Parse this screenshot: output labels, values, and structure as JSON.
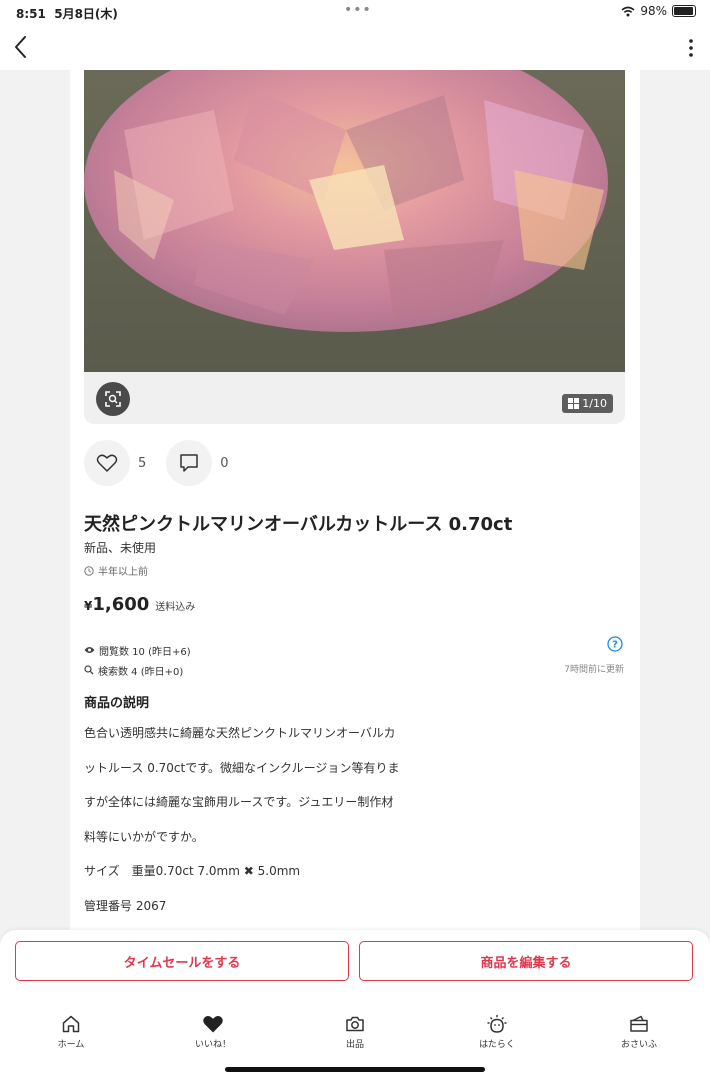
{
  "status_bar": {
    "time": "8:51",
    "date": "5月8日(木)",
    "battery": "98%"
  },
  "item": {
    "image_counter": "1/10",
    "likes": "5",
    "comments": "0",
    "title": "天然ピンクトルマリンオーバルカットルース 0.70ct",
    "condition": "新品、未使用",
    "posted": "半年以上前",
    "price_symbol": "¥",
    "price": "1,600",
    "shipping": "送料込み"
  },
  "stats": {
    "views": "閲覧数  10 (昨日+6)",
    "searches": "検索数  4 (昨日+0)",
    "updated": "7時間前に更新"
  },
  "description": {
    "heading": "商品の説明",
    "lines": [
      "色合い透明感共に綺麗な天然ピンクトルマリンオーバルカ",
      "ットルース 0.70ctです。微細なインクルージョン等有りま",
      "すが全体には綺麗な宝飾用ルースです。ジュエリー制作材",
      "料等にいかがですか。",
      "サイズ　重量0.70ct 7.0mm ✖ 5.0mm",
      "管理番号 2067"
    ]
  },
  "actions": {
    "timesale": "タイムセールをする",
    "edit": "商品を編集する"
  },
  "tabs": [
    {
      "label": "ホーム",
      "icon": "home-icon"
    },
    {
      "label": "いいね！",
      "icon": "heart-icon"
    },
    {
      "label": "出品",
      "icon": "camera-icon"
    },
    {
      "label": "はたらく",
      "icon": "work-icon"
    },
    {
      "label": "おさいふ",
      "icon": "wallet-icon"
    }
  ],
  "colors": {
    "accent": "#e0394e",
    "gem": "#e89aa8"
  }
}
